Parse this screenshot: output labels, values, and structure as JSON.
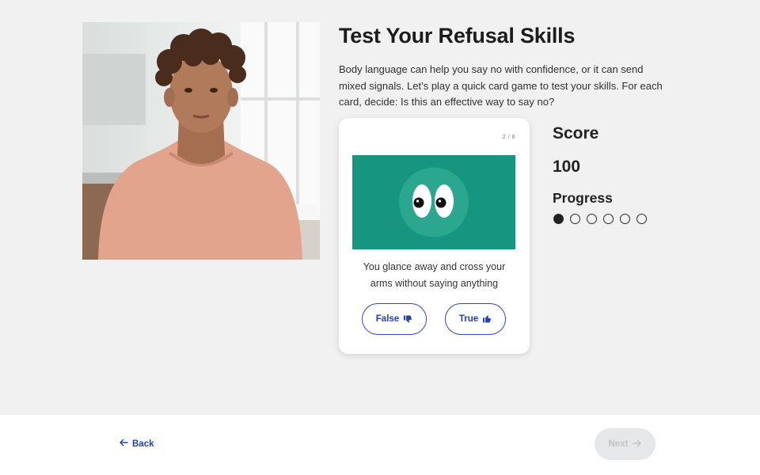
{
  "activity": {
    "title": "Test Your Refusal Skills",
    "intro": "Body language can help you say no with confidence, or it can send mixed signals. Let’s play a quick card game to test your skills. For each card, decide: Is this an effective way to say no?"
  },
  "card": {
    "counter": "2 / 8",
    "statement": "You glance away and cross your arms without saying anything",
    "false_label": "False",
    "true_label": "True",
    "illustration": "eyes-looking-sideways-icon",
    "illustration_bg": "#169680"
  },
  "score": {
    "label": "Score",
    "value": "100"
  },
  "progress": {
    "label": "Progress",
    "completed": 1,
    "total": 6
  },
  "footer": {
    "back_label": "Back",
    "next_label": "Next",
    "next_enabled": false
  },
  "colors": {
    "accent": "#2340c2",
    "background": "#f0f1f0",
    "card_green": "#169680"
  }
}
